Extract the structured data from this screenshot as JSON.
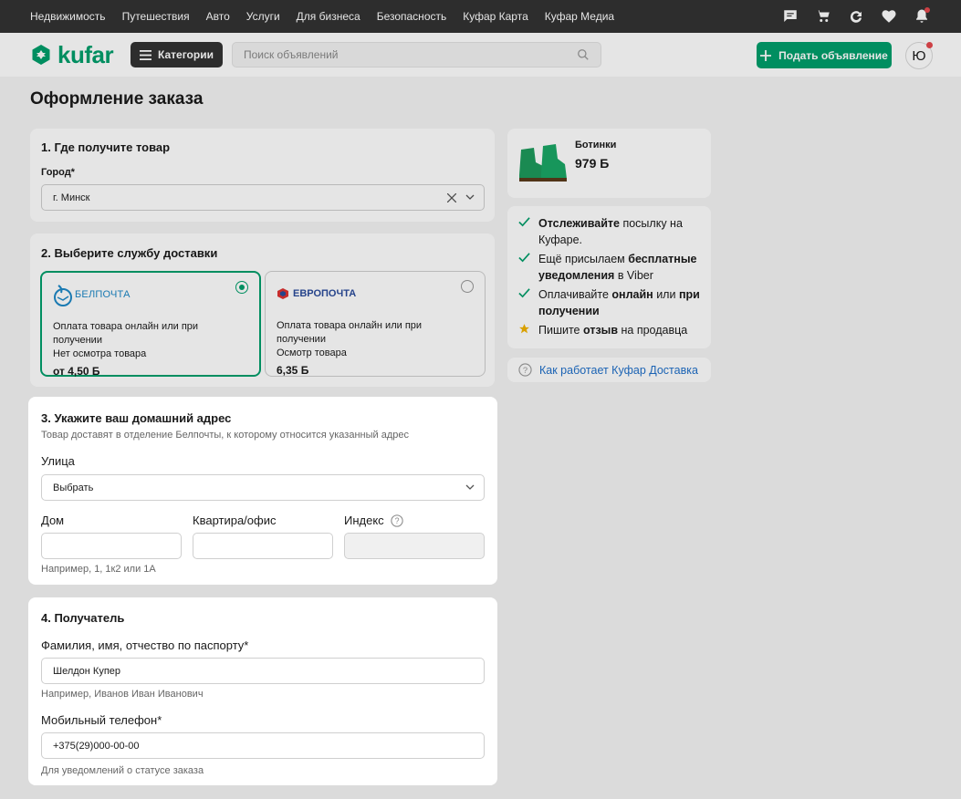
{
  "topnav": {
    "links": [
      "Недвижимость",
      "Путешествия",
      "Авто",
      "Услуги",
      "Для бизнеса",
      "Безопасность",
      "Куфар Карта",
      "Куфар Медиа"
    ],
    "icons": [
      "chat-icon",
      "cart-icon",
      "deals-icon",
      "heart-icon",
      "bell-icon"
    ]
  },
  "header": {
    "logo": "kufar",
    "categories_label": "Категории",
    "search_placeholder": "Поиск объявлений",
    "post_label": "Подать объявление",
    "avatar_letter": "Ю"
  },
  "page": {
    "title": "Оформление заказа"
  },
  "section1": {
    "title": "1. Где получите товар",
    "city_label": "Город*",
    "city_value": "г. Минск"
  },
  "section2": {
    "title": "2. Выберите службу доставки",
    "options": [
      {
        "name": "БЕЛПОЧТА",
        "desc1": "Оплата товара онлайн или при получении",
        "desc2": "Нет осмотра товара",
        "price": "от 4,50 Б",
        "selected": true
      },
      {
        "name": "ЕВРОПОЧТА",
        "desc1": "Оплата товара онлайн или при получении",
        "desc2": "Осмотр товара",
        "price": "6,35 Б",
        "selected": false
      }
    ]
  },
  "section3": {
    "title": "3. Укажите ваш домашний адрес",
    "subtitle": "Товар доставят в отделение Белпочты, к которому относится указанный адрес",
    "street_label": "Улица",
    "street_value": "Выбрать",
    "house_label": "Дом",
    "apt_label": "Квартира/офис",
    "index_label": "Индекс",
    "house_hint": "Например, 1, 1к2 или 1А"
  },
  "section4": {
    "title": "4. Получатель",
    "name_label": "Фамилия, имя, отчество по паспорту*",
    "name_value": "Шелдон Купер",
    "name_hint": "Например, Иванов Иван Иванович",
    "phone_label": "Мобильный телефон*",
    "phone_value": "+375(29)000-00-00",
    "phone_hint": "Для уведомлений о статусе заказа"
  },
  "product": {
    "name": "Ботинки",
    "price": "979 Б"
  },
  "benefits": {
    "items": [
      {
        "icon": "check-icon",
        "parts": [
          [
            "Отслеживайте",
            true
          ],
          [
            " посылку на Куфаре.",
            false
          ]
        ]
      },
      {
        "icon": "check-icon",
        "parts": [
          [
            "Ещё присылаем ",
            false
          ],
          [
            "бесплатные уведомления",
            true
          ],
          [
            " в Viber",
            false
          ]
        ]
      },
      {
        "icon": "check-icon",
        "parts": [
          [
            "Оплачивайте ",
            false
          ],
          [
            "онлайн",
            true
          ],
          [
            " или ",
            false
          ],
          [
            "при получении",
            true
          ]
        ]
      },
      {
        "icon": "star-icon",
        "parts": [
          [
            "Пишите ",
            false
          ],
          [
            "отзыв",
            true
          ],
          [
            " на продавца",
            false
          ]
        ]
      }
    ]
  },
  "help": {
    "link": "Как работает Куфар Доставка"
  },
  "colors": {
    "accent": "#009f6b",
    "link": "#1f6fc9",
    "star": "#f2b300",
    "dark": "#333333"
  }
}
